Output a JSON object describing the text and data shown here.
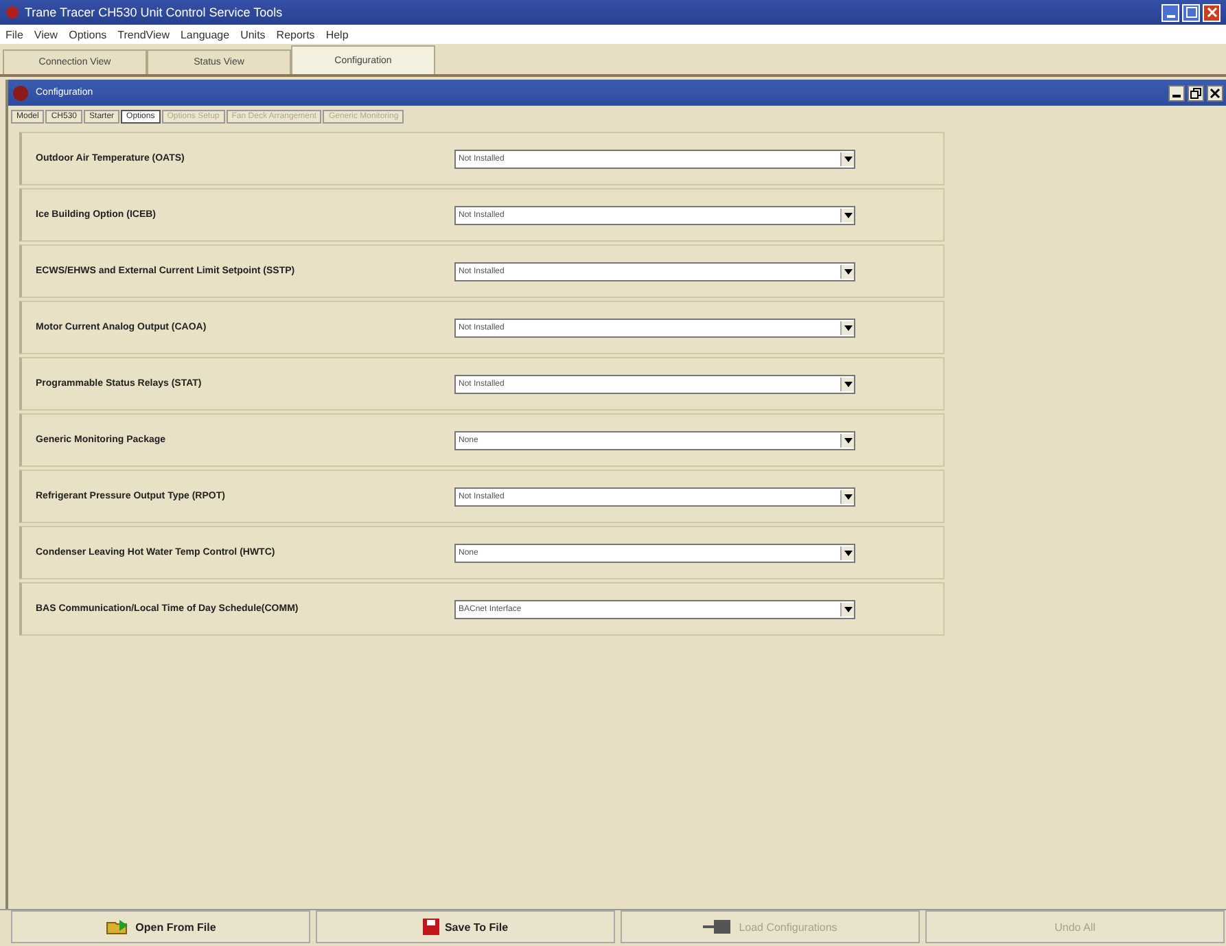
{
  "window": {
    "title": "Trane Tracer CH530 Unit Control Service Tools"
  },
  "menu": [
    "File",
    "View",
    "Options",
    "TrendView",
    "Language",
    "Units",
    "Reports",
    "Help"
  ],
  "tabs": [
    {
      "label": "Connection View",
      "selected": false
    },
    {
      "label": "Status View",
      "selected": false
    },
    {
      "label": "Configuration",
      "selected": true
    }
  ],
  "child_window": {
    "title": "Configuration"
  },
  "sub_tabs": [
    {
      "label": "Model",
      "selected": false,
      "disabled": false
    },
    {
      "label": "CH530",
      "selected": false,
      "disabled": false
    },
    {
      "label": "Starter",
      "selected": false,
      "disabled": false
    },
    {
      "label": "Options",
      "selected": true,
      "disabled": false
    },
    {
      "label": "Options Setup",
      "selected": false,
      "disabled": true
    },
    {
      "label": "Fan Deck Arrangement",
      "selected": false,
      "disabled": true
    },
    {
      "label": "Generic Monitoring",
      "selected": false,
      "disabled": true
    }
  ],
  "options": [
    {
      "label": "Outdoor Air Temperature (OATS)",
      "value": "Not Installed"
    },
    {
      "label": "Ice Building Option (ICEB)",
      "value": "Not Installed"
    },
    {
      "label": "ECWS/EHWS and External Current Limit Setpoint (SSTP)",
      "value": "Not Installed"
    },
    {
      "label": "Motor Current Analog Output (CAOA)",
      "value": "Not Installed"
    },
    {
      "label": "Programmable Status Relays (STAT)",
      "value": "Not Installed"
    },
    {
      "label": "Generic Monitoring Package",
      "value": "None"
    },
    {
      "label": "Refrigerant Pressure Output Type (RPOT)",
      "value": "Not Installed"
    },
    {
      "label": "Condenser Leaving Hot Water Temp Control (HWTC)",
      "value": "None"
    },
    {
      "label": "BAS Communication/Local Time of Day Schedule(COMM)",
      "value": "BACnet Interface"
    }
  ],
  "buttons": [
    {
      "kind": "open",
      "label": "Open From File",
      "disabled": false
    },
    {
      "kind": "save",
      "label": "Save To File",
      "disabled": false
    },
    {
      "kind": "load",
      "label": "Load Configurations",
      "disabled": true
    },
    {
      "kind": "undo",
      "label": "Undo All",
      "disabled": true
    }
  ]
}
